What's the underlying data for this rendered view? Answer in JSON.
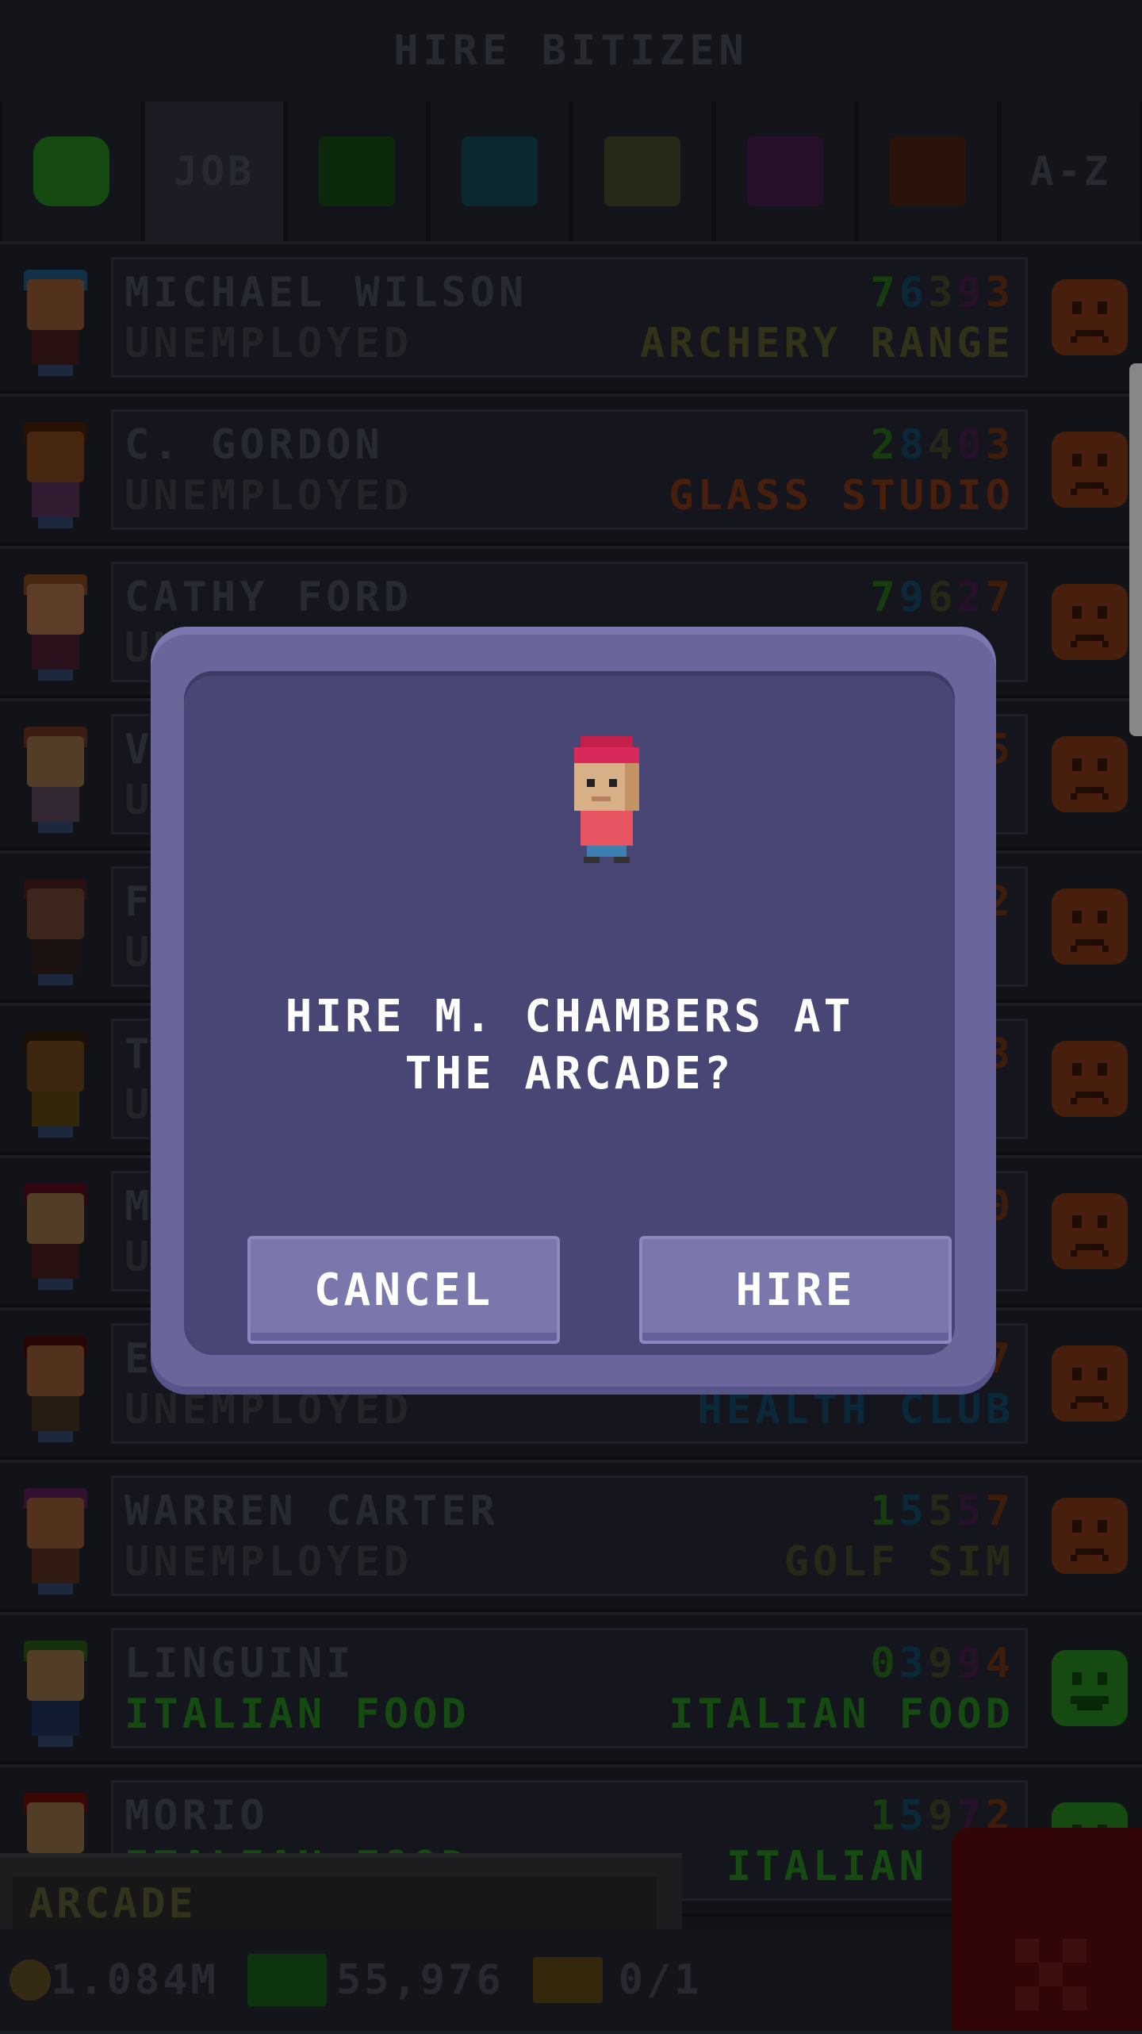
{
  "header": {
    "title": "HIRE BITIZEN"
  },
  "tabs": [
    {
      "label": "",
      "kind": "mood",
      "color": "#1f6e1a"
    },
    {
      "label": "JOB",
      "kind": "text"
    },
    {
      "label": "",
      "kind": "color",
      "color": "#133d12"
    },
    {
      "label": "",
      "kind": "color",
      "color": "#0f3b45"
    },
    {
      "label": "",
      "kind": "color",
      "color": "#3c3c22"
    },
    {
      "label": "",
      "kind": "color",
      "color": "#3a1a3e"
    },
    {
      "label": "",
      "kind": "color",
      "color": "#3f1e0f"
    },
    {
      "label": "A-Z",
      "kind": "text"
    }
  ],
  "bitizens": [
    {
      "name": "MICHAEL WILSON",
      "status": "UNEMPLOYED",
      "stats": [
        "7",
        "6",
        "3",
        "9",
        "3"
      ],
      "dream": "ARCHERY RANGE",
      "dream_color": "#4a4a24",
      "mood": "sad",
      "hat": "#1a4a6a",
      "head": "#7a4a2a",
      "body": "#3f1a1a"
    },
    {
      "name": "C. GORDON",
      "status": "UNEMPLOYED",
      "stats": [
        "2",
        "8",
        "4",
        "0",
        "3"
      ],
      "dream": "GLASS STUDIO",
      "dream_color": "#6a2e12",
      "mood": "sad",
      "hat": "#3a1a0a",
      "head": "#6a3a1a",
      "body": "#4a2a4a"
    },
    {
      "name": "CATHY FORD",
      "status": "UNEMPLOYED",
      "stats": [
        "7",
        "9",
        "6",
        "2",
        "7"
      ],
      "dream": "",
      "dream_color": "#0f3b55",
      "mood": "sad",
      "hat": "#6a3a1a",
      "head": "#8a5a3a",
      "body": "#3f1a2a"
    },
    {
      "name": "V",
      "status": "UNEMPLOYED",
      "stats": [
        "",
        "",
        "",
        "",
        "5"
      ],
      "dream": "",
      "dream_color": "#6a2e12",
      "mood": "sad",
      "hat": "#5a2a1a",
      "head": "#7a5a3a",
      "body": "#4a3a4a"
    },
    {
      "name": "F",
      "status": "UNEMPLOYED",
      "stats": [
        "",
        "",
        "",
        "",
        "2"
      ],
      "dream": "",
      "dream_color": "#4a4a24",
      "mood": "sad",
      "hat": "#3a1a1a",
      "head": "#5a3a2a",
      "body": "#2a1a1a"
    },
    {
      "name": "T",
      "status": "UNEMPLOYED",
      "stats": [
        "",
        "",
        "",
        "",
        "3"
      ],
      "dream": "",
      "dream_color": "#1f6e1a",
      "mood": "sad",
      "hat": "#2a1a0a",
      "head": "#5a3a1a",
      "body": "#4a3a0a"
    },
    {
      "name": "M",
      "status": "UNEMPLOYED",
      "stats": [
        "",
        "",
        "",
        "",
        "0"
      ],
      "dream": "",
      "dream_color": "#3a1a3e",
      "mood": "sad",
      "hat": "#4a0a1a",
      "head": "#7a5a3a",
      "body": "#3f1a1a"
    },
    {
      "name": "E.",
      "status": "UNEMPLOYED",
      "stats": [
        "",
        "",
        "",
        "",
        "7"
      ],
      "dream": "HEALTH CLUB",
      "dream_color": "#0f3b55",
      "mood": "sad",
      "hat": "#3a0a0a",
      "head": "#7a4a2a",
      "body": "#3a2a1a"
    },
    {
      "name": "WARREN CARTER",
      "status": "UNEMPLOYED",
      "stats": [
        "1",
        "5",
        "5",
        "5",
        "7"
      ],
      "dream": "GOLF SIM",
      "dream_color": "#3c3c22",
      "mood": "sad",
      "hat": "#4a1a4a",
      "head": "#7a4a2a",
      "body": "#4a2a1a"
    },
    {
      "name": "LINGUINI",
      "status": "ITALIAN FOOD",
      "stats": [
        "0",
        "3",
        "9",
        "9",
        "4"
      ],
      "dream": "ITALIAN FOOD",
      "dream_color": "#1f6e1a",
      "mood": "happy",
      "hat": "#1f4a12",
      "head": "#7a5a3a",
      "body": "#1a2a4a"
    },
    {
      "name": "MORIO",
      "status": "ITALIAN FOOD",
      "stats": [
        "1",
        "5",
        "9",
        "7",
        "2"
      ],
      "dream": "ITALIAN FO",
      "dream_color": "#1f6e1a",
      "mood": "happy",
      "hat": "#5a0a0a",
      "head": "#7a5a3a",
      "body": "#1a2a4a"
    }
  ],
  "stat_colors": [
    "#1f5a16",
    "#0f3b55",
    "#3a3a22",
    "#3a1a3e",
    "#5a2a12"
  ],
  "dialog": {
    "message": "HIRE M. CHAMBERS AT THE ARCADE?",
    "cancel_label": "CANCEL",
    "hire_label": "HIRE"
  },
  "floor_field": {
    "value": "ARCADE"
  },
  "footer": {
    "coins": "1.084M",
    "bux": "55,976",
    "chests": "0/1"
  },
  "icons": {
    "close": "close-x-icon",
    "coin": "coin-icon",
    "bux": "bux-icon",
    "chest": "chest-icon"
  }
}
